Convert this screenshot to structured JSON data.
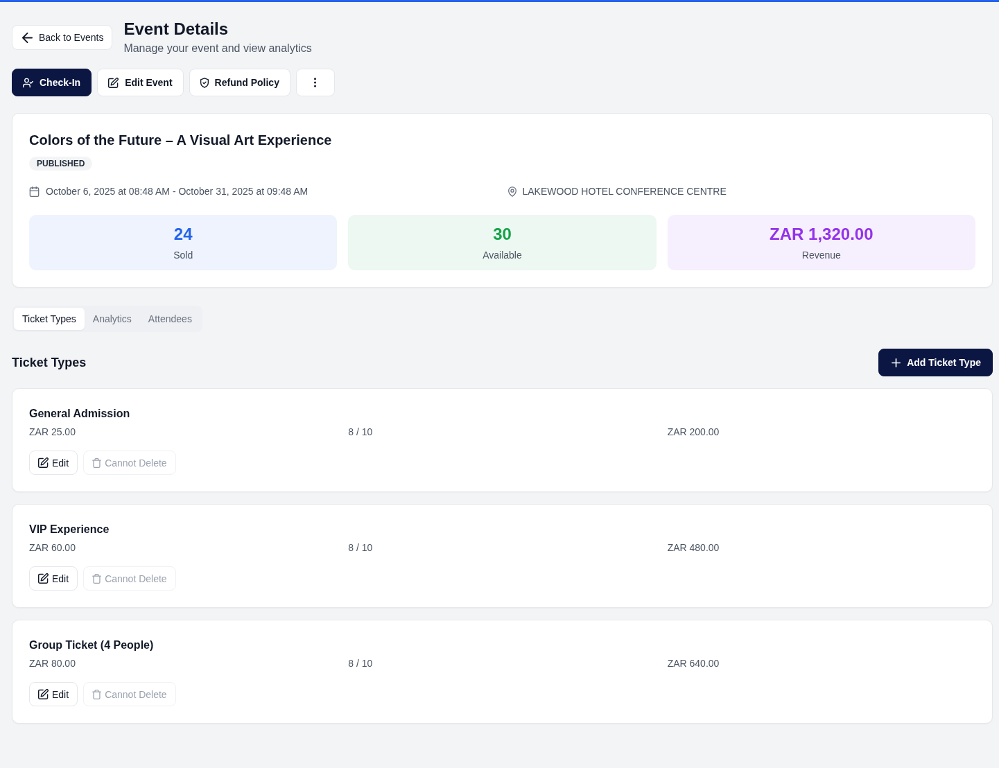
{
  "header": {
    "back_button": "Back to Events",
    "title": "Event Details",
    "subtitle": "Manage your event and view analytics"
  },
  "actions": [
    {
      "kind": "primary",
      "label": "Check-In"
    },
    {
      "kind": "outline",
      "label": "Edit Event"
    },
    {
      "kind": "outline",
      "label": "Refund Policy"
    },
    {
      "kind": "icon"
    }
  ],
  "event": {
    "title": "Colors of the Future – A Visual Art Experience",
    "status": "PUBLISHED",
    "date_range": "October 6, 2025 at 08:48 AM - October 31, 2025 at 09:48 AM",
    "venue": "LAKEWOOD HOTEL CONFERENCE CENTRE",
    "stats": [
      {
        "value": "24",
        "label": "Sold",
        "color": "#2563eb"
      },
      {
        "value": "30",
        "label": "Available",
        "color": "#16a34a"
      },
      {
        "value": "ZAR 1,320.00",
        "label": "Revenue",
        "color": "#9333ea"
      }
    ]
  },
  "tabs": [
    {
      "label": "Ticket Types",
      "selected": true
    },
    {
      "label": "Analytics",
      "selected": false
    },
    {
      "label": "Attendees",
      "selected": false
    }
  ],
  "ticket_section": {
    "heading": "Ticket Types",
    "add_button": "Add Ticket Type",
    "tickets": [
      {
        "name": "General Admission",
        "price": "ZAR 25.00",
        "quantity": "8 / 10",
        "revenue": "ZAR 200.00",
        "edit_button": "Edit",
        "delete_button": {
          "label": "Cannot Delete",
          "disabled": true
        }
      },
      {
        "name": "VIP Experience",
        "price": "ZAR 60.00",
        "quantity": "8 / 10",
        "revenue": "ZAR 480.00",
        "edit_button": "Edit",
        "delete_button": {
          "label": "Cannot Delete",
          "disabled": true
        }
      },
      {
        "name": "Group Ticket (4 People)",
        "price": "ZAR 80.00",
        "quantity": "8 / 10",
        "revenue": "ZAR 640.00",
        "edit_button": "Edit",
        "delete_button": {
          "label": "Cannot Delete",
          "disabled": true
        }
      }
    ]
  }
}
